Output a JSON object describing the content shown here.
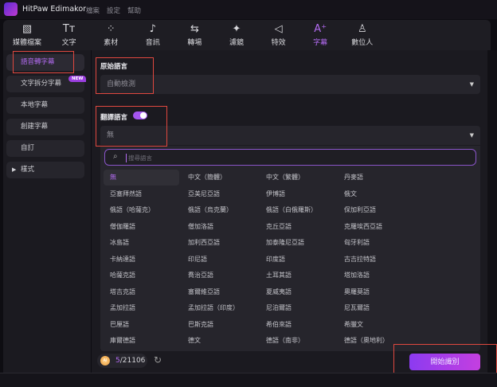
{
  "app": {
    "title": "HitPaw Edimakor",
    "menu": [
      "檔案",
      "設定",
      "幫助"
    ]
  },
  "toolbar": {
    "items": [
      {
        "label": "媒體檔案",
        "icon": "media-icon",
        "glyph": "▧"
      },
      {
        "label": "文字",
        "icon": "text-icon",
        "glyph": "Tт"
      },
      {
        "label": "素材",
        "icon": "elements-icon",
        "glyph": "⁘"
      },
      {
        "label": "音訊",
        "icon": "audio-icon",
        "glyph": "♪"
      },
      {
        "label": "轉場",
        "icon": "transition-icon",
        "glyph": "⇆"
      },
      {
        "label": "濾鏡",
        "icon": "filter-icon",
        "glyph": "✦"
      },
      {
        "label": "特效",
        "icon": "effects-icon",
        "glyph": "◁"
      },
      {
        "label": "字幕",
        "icon": "subtitle-icon",
        "glyph": "A⁺"
      },
      {
        "label": "數位人",
        "icon": "avatar-icon",
        "glyph": "♙"
      }
    ],
    "active": "字幕"
  },
  "sidebar": {
    "items": [
      "語音轉字幕",
      "文字拆分字幕",
      "本地字幕",
      "創建字幕",
      "自訂",
      "樣式"
    ],
    "active": "語音轉字幕",
    "new_badge": "NEW"
  },
  "source_language": {
    "label": "原始語言",
    "value": "自動檢測"
  },
  "translate_language": {
    "label": "翻譯語言",
    "enabled": true,
    "value": "無"
  },
  "search": {
    "placeholder": "搜尋語言"
  },
  "languages": [
    "無",
    "中文（簡體）",
    "中文（繁體）",
    "丹麥語",
    "亞塞拜然語",
    "亞美尼亞語",
    "伊博語",
    "俄文",
    "俄語（哈薩克）",
    "俄語（烏克蘭）",
    "俄語（白俄羅斯）",
    "保加利亞語",
    "僧伽羅語",
    "僧加洛語",
    "克丘亞語",
    "克羅埃西亞語",
    "冰島語",
    "加利西亞語",
    "加泰隆尼亞語",
    "匈牙利語",
    "卡納達語",
    "印尼語",
    "印度語",
    "古吉拉特語",
    "哈薩克語",
    "喬治亞語",
    "土耳其語",
    "塔加洛語",
    "塔吉克語",
    "塞爾維亞語",
    "夏威夷語",
    "奧羅莫語",
    "孟加拉語",
    "孟加拉語（印度）",
    "尼泊爾語",
    "尼瓦爾語",
    "巴厘語",
    "巴斯克語",
    "希伯來語",
    "希臘文",
    "庫爾德語",
    "德文",
    "德語（南非）",
    "德語（奧地利）"
  ],
  "selected_language": "無",
  "footer": {
    "ai_label": "AI",
    "credits_used": "5",
    "credits_total": "/21106",
    "start_button": "開始識別"
  },
  "colors": {
    "accent": "#b46cf3",
    "highlight_box": "#e0483f"
  }
}
